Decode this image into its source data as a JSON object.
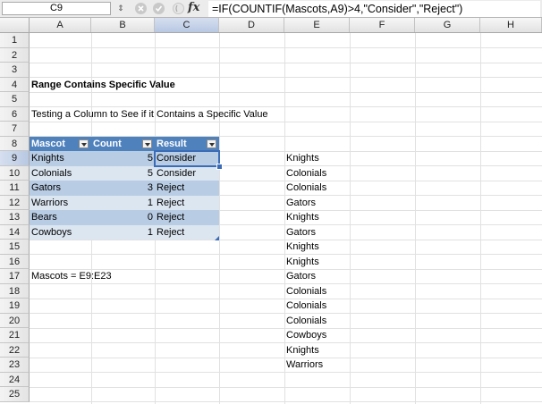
{
  "formula_bar": {
    "name_box": "C9",
    "fx_label": "fx",
    "formula": "=IF(COUNTIF(Mascots,A9)>4,\"Consider\",\"Reject\")"
  },
  "columns": [
    "A",
    "B",
    "C",
    "D",
    "E",
    "F",
    "G",
    "H"
  ],
  "rows": [
    "1",
    "2",
    "3",
    "4",
    "5",
    "6",
    "7",
    "8",
    "9",
    "10",
    "11",
    "12",
    "13",
    "14",
    "15",
    "16",
    "17",
    "18",
    "19",
    "20",
    "21",
    "22",
    "23",
    "24",
    "25"
  ],
  "sheet": {
    "title": "Range Contains Specific Value",
    "subtitle": "Testing a Column to See if it Contains a Specific Value",
    "named_range_note": "Mascots = E9:E23"
  },
  "table": {
    "headers": [
      "Mascot",
      "Count",
      "Result"
    ],
    "rows": [
      {
        "mascot": "Knights",
        "count": "5",
        "result": "Consider"
      },
      {
        "mascot": "Colonials",
        "count": "5",
        "result": "Consider"
      },
      {
        "mascot": "Gators",
        "count": "3",
        "result": "Reject"
      },
      {
        "mascot": "Warriors",
        "count": "1",
        "result": "Reject"
      },
      {
        "mascot": "Bears",
        "count": "0",
        "result": "Reject"
      },
      {
        "mascot": "Cowboys",
        "count": "1",
        "result": "Reject"
      }
    ]
  },
  "mascots_list": [
    "Knights",
    "Colonials",
    "Colonials",
    "Gators",
    "Knights",
    "Gators",
    "Knights",
    "Knights",
    "Gators",
    "Colonials",
    "Colonials",
    "Colonials",
    "Cowboys",
    "Knights",
    "Warriors"
  ],
  "colors": {
    "header_blue": "#4f81bd",
    "band_dark": "#b8cce4",
    "band_light": "#dce6f1",
    "selection": "#3b6cb8"
  }
}
